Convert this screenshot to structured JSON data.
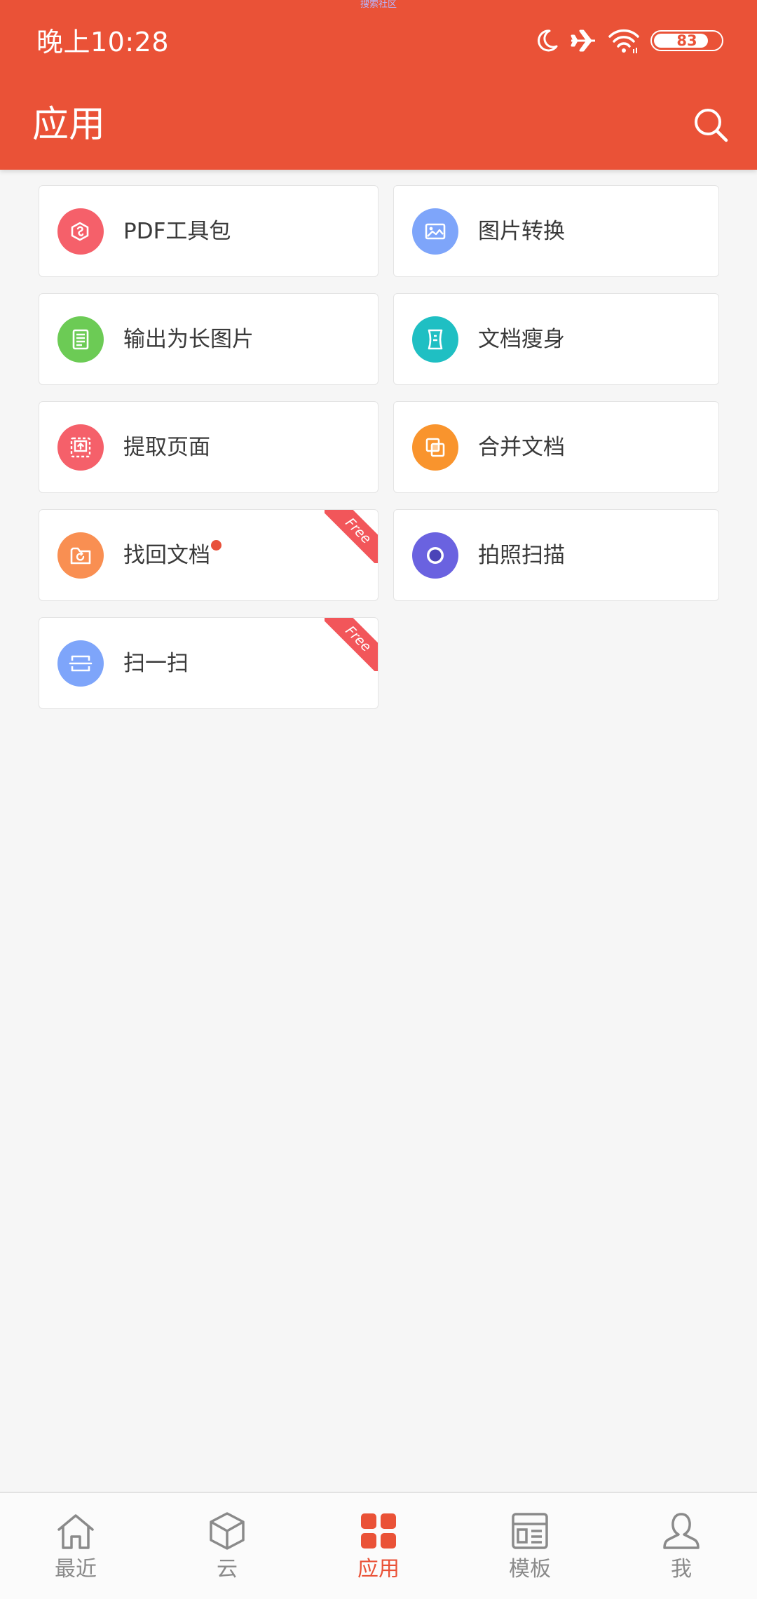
{
  "colors": {
    "brand": "#ea5237",
    "background": "#f6f6f6",
    "nav_inactive": "#8a8a8a"
  },
  "status_bar": {
    "caption": "搜索社区",
    "time": "晚上10:28",
    "battery": "83",
    "battery_level": 0.83,
    "icons": [
      "moon-icon",
      "airplane-icon",
      "wifi-icon",
      "battery-icon"
    ]
  },
  "header": {
    "title": "应用",
    "search_icon": "search-icon"
  },
  "apps": [
    {
      "label": "PDF工具包",
      "icon": "pdf-toolkit-icon",
      "color": "#f5606a",
      "free": false,
      "dot": false
    },
    {
      "label": "图片转换",
      "icon": "image-convert-icon",
      "color": "#7ea5fa",
      "free": false,
      "dot": false
    },
    {
      "label": "输出为长图片",
      "icon": "long-image-icon",
      "color": "#6ccb55",
      "free": false,
      "dot": false
    },
    {
      "label": "文档瘦身",
      "icon": "doc-slim-icon",
      "color": "#1fbfc3",
      "free": false,
      "dot": false
    },
    {
      "label": "提取页面",
      "icon": "extract-page-icon",
      "color": "#f5606a",
      "free": false,
      "dot": false
    },
    {
      "label": "合并文档",
      "icon": "merge-doc-icon",
      "color": "#f9942d",
      "free": false,
      "dot": false
    },
    {
      "label": "找回文档",
      "icon": "recover-doc-icon",
      "color": "#f98f52",
      "free": true,
      "free_label": "Free",
      "dot": true
    },
    {
      "label": "拍照扫描",
      "icon": "camera-scan-icon",
      "color": "#6a62e0",
      "free": false,
      "dot": false
    },
    {
      "label": "扫一扫",
      "icon": "scan-icon",
      "color": "#7ea5fa",
      "free": true,
      "free_label": "Free",
      "dot": false
    }
  ],
  "bottom_nav": [
    {
      "label": "最近",
      "icon": "home-icon",
      "active": false
    },
    {
      "label": "云",
      "icon": "cloud-box-icon",
      "active": false
    },
    {
      "label": "应用",
      "icon": "apps-grid-icon",
      "active": true
    },
    {
      "label": "模板",
      "icon": "template-icon",
      "active": false
    },
    {
      "label": "我",
      "icon": "profile-icon",
      "active": false
    }
  ]
}
